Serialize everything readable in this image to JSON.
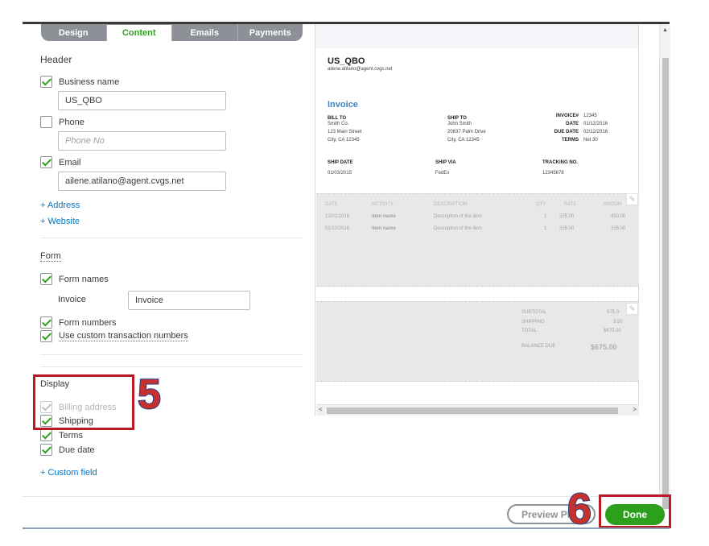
{
  "tabs": [
    {
      "label": "Design"
    },
    {
      "label": "Content",
      "active": true
    },
    {
      "label": "Emails"
    },
    {
      "label": "Payments"
    }
  ],
  "header_section": {
    "title": "Header",
    "business_name_label": "Business name",
    "business_name_value": "US_QBO",
    "phone_label": "Phone",
    "phone_placeholder": "Phone No",
    "email_label": "Email",
    "email_value": "ailene.atilano@agent.cvgs.net",
    "add_address": "+ Address",
    "add_website": "+ Website"
  },
  "form_section": {
    "title": "Form",
    "form_names_label": "Form names",
    "invoice_label": "Invoice",
    "invoice_value": "Invoice",
    "form_numbers_label": "Form numbers",
    "custom_txn_label": "Use custom transaction numbers"
  },
  "display_section": {
    "title": "Display",
    "billing_address_label": "Billing address",
    "shipping_label": "Shipping",
    "terms_label": "Terms",
    "due_date_label": "Due date",
    "add_custom_field": "+ Custom field"
  },
  "annotations": {
    "step5": "5",
    "step6": "6",
    "color": "#b81923"
  },
  "preview": {
    "company": "US_QBO",
    "email": "ailene.atilano@agent.cvgs.net",
    "doc_title": "Invoice",
    "bill_to_head": "BILL TO",
    "bill_to_lines": "Smith Co.\n123 Main Street\nCity, CA 12345",
    "ship_to_head": "SHIP TO",
    "ship_to_lines": "John Smith\n20637 Palm Drive\nCity, CA 12345",
    "meta_labels": "INVOICE#\nDATE\nDUE DATE\nTERMS",
    "meta_values": "12345\n01/12/2016\n02/12/2016\nNet 30",
    "ship_date_head": "SHIP DATE",
    "ship_date": "01/03/2015",
    "ship_via_head": "SHIP VIA",
    "ship_via": "FedEx",
    "tracking_head": "TRACKING NO.",
    "tracking": "12345678",
    "columns": {
      "date": "DATE",
      "activity": "ACTIVITY",
      "description": "DESCRIPTION",
      "qty": "QTY",
      "rate": "RATE",
      "amount": "AMOUN"
    },
    "rows": [
      {
        "date": "12/01/2016",
        "activity": "Item name",
        "description": "Description of the item",
        "qty": "2",
        "rate": "225.00",
        "amount": "450.00"
      },
      {
        "date": "01/12/2016",
        "activity": "Item name",
        "description": "Description of the item",
        "qty": "1",
        "rate": "225.00",
        "amount": "225.00"
      }
    ],
    "subtotal_label": "SUBTOTAL",
    "subtotal": "675.0",
    "shipping_label": "SHIPPING",
    "shipping": "3.50",
    "total_label": "TOTAL",
    "total": "$675.00",
    "balance_label": "BALANCE DUE",
    "balance": "$675.00"
  },
  "footer": {
    "preview_btn": "Preview Pl",
    "done_btn": "Done"
  },
  "colors": {
    "accent": "#2ca01c",
    "link": "#0077c5",
    "preview_heading": "#3c84c6"
  }
}
